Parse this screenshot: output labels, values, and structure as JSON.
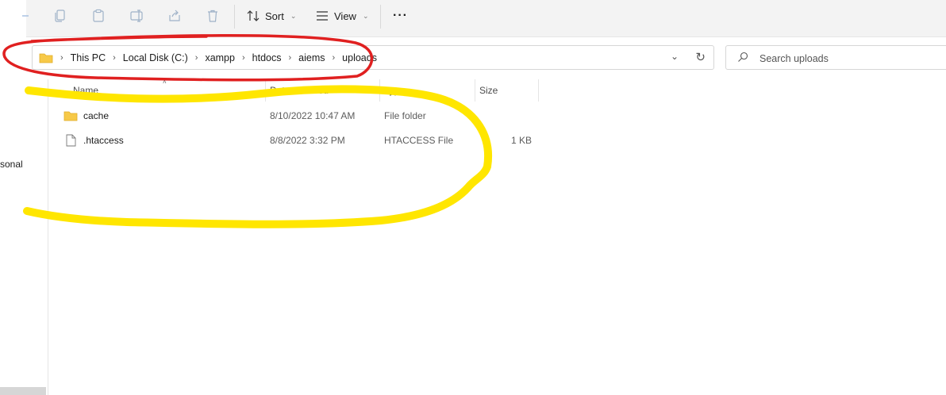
{
  "toolbar": {
    "sort_label": "Sort",
    "view_label": "View",
    "more_label": "···"
  },
  "address": {
    "crumbs": [
      "This PC",
      "Local Disk (C:)",
      "xampp",
      "htdocs",
      "aiems",
      "uploads"
    ]
  },
  "search": {
    "placeholder": "Search uploads"
  },
  "nav": {
    "partial_label": "sonal"
  },
  "columns": {
    "name": "Name",
    "date_modified": "Date modified",
    "type": "Type",
    "size": "Size"
  },
  "files": [
    {
      "name": "cache",
      "date": "8/10/2022 10:47 AM",
      "type": "File folder",
      "size": "",
      "icon": "folder-icon"
    },
    {
      "name": ".htaccess",
      "date": "8/8/2022 3:32 PM",
      "type": "HTACCESS File",
      "size": "1 KB",
      "icon": "file-icon"
    }
  ],
  "colors": {
    "red_annotation": "#e02020",
    "yellow_annotation": "#ffe600",
    "folder": "#f7c948"
  }
}
